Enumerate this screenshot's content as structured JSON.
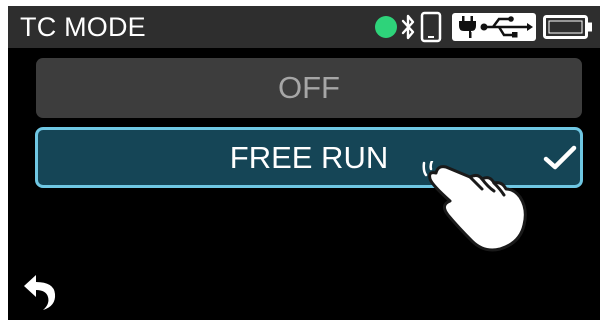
{
  "header": {
    "title": "TC MODE",
    "status_color": "#2ed37a",
    "icons": [
      "status-indicator",
      "bluetooth-icon",
      "smartphone-icon",
      "usb-power-icon",
      "battery-icon"
    ]
  },
  "options": [
    {
      "label": "OFF",
      "selected": false
    },
    {
      "label": "FREE RUN",
      "selected": true
    }
  ],
  "colors": {
    "header_bg": "#2e2e2e",
    "option_bg": "#3d3d3d",
    "selected_bg": "#154556",
    "selected_border": "#6fc7e3"
  },
  "overlay_icon": "tapping-hand-icon",
  "footer": {
    "back_icon": "back-arrow-icon"
  }
}
